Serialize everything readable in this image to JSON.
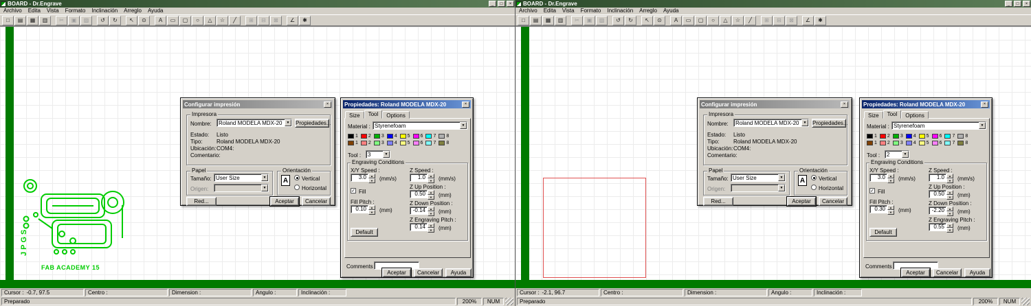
{
  "s": {
    "window_title": "BOARD - Dr.Engrave",
    "titlebar": {
      "minimize": "_",
      "maximize": "□",
      "close": "×"
    },
    "menu": [
      "Archivo",
      "Edita",
      "Vista",
      "Formato",
      "Inclinación",
      "Arreglo",
      "Ayuda"
    ],
    "toolbar": [
      {
        "name": "new",
        "glyph": "□"
      },
      {
        "name": "open",
        "glyph": "▤"
      },
      {
        "name": "save",
        "glyph": "▦"
      },
      {
        "name": "print",
        "glyph": "▥"
      },
      {
        "name": "cut",
        "glyph": "✂"
      },
      {
        "name": "copy",
        "glyph": "▣"
      },
      {
        "name": "paste",
        "glyph": "▨"
      },
      {
        "name": "undo",
        "glyph": "↺"
      },
      {
        "name": "redo",
        "glyph": "↻"
      },
      {
        "name": "select",
        "glyph": "↖"
      },
      {
        "name": "zoom",
        "glyph": "⊙"
      },
      {
        "name": "text",
        "glyph": "A"
      },
      {
        "name": "rectangle",
        "glyph": "▭"
      },
      {
        "name": "rounded-rectangle",
        "glyph": "▢"
      },
      {
        "name": "ellipse",
        "glyph": "○"
      },
      {
        "name": "polygon",
        "glyph": "△"
      },
      {
        "name": "star",
        "glyph": "☆"
      },
      {
        "name": "line",
        "glyph": "╱"
      },
      {
        "name": "align-left",
        "glyph": "⊞"
      },
      {
        "name": "align-center",
        "glyph": "⊟"
      },
      {
        "name": "align-right",
        "glyph": "⊠"
      },
      {
        "name": "measure",
        "glyph": "∠"
      },
      {
        "name": "settings",
        "glyph": "✱"
      }
    ],
    "print": {
      "title": "Configurar impresión",
      "close": "×",
      "printer_group": "Impresora",
      "name_label": "Nombre:",
      "printer_name": "Roland MODELA MDX-20",
      "properties_button": "Propiedades...",
      "status_label": "Estado:",
      "status_value": "Listo",
      "type_label": "Tipo:",
      "type_value": "Roland MODELA MDX-20",
      "location_label": "Ubicación:",
      "location_value": "COM4:",
      "comment_label": "Comentario:",
      "paper_group": "Papel",
      "size_label": "Tamaño:",
      "size_value": "User Size",
      "source_label": "Origen:",
      "orientation_group": "Orientación",
      "orientation_icon": "A",
      "vertical_label": "Vertical",
      "horizontal_label": "Horizontal",
      "network_button": "Red...",
      "ok_button": "Aceptar",
      "cancel_button": "Cancelar"
    },
    "props": {
      "title": "Propiedades: Roland MODELA MDX-20",
      "close": "×",
      "tabs": [
        "Size",
        "Tool",
        "Options"
      ],
      "material_label": "Material :",
      "material_value": "Styrenefoam",
      "tool_label": "Tool :",
      "conditions_group": "Engraving Conditions",
      "xy_speed_label": "X/Y Speed :",
      "z_speed_label": "Z Speed :",
      "fill_label": "Fill",
      "z_up_label": "Z Up Position :",
      "fill_pitch_label": "Fill Pitch :",
      "z_down_label": "Z Down Position :",
      "z_engraving_label": "Z Engraving Pitch :",
      "unit_mms": "(mm/s)",
      "unit_mm": "(mm)",
      "default_button": "Default",
      "comments_label": "Comments :",
      "ok_button": "Aceptar",
      "cancel_button": "Cancelar",
      "help_button": "Ayuda"
    },
    "palette": {
      "numbers": [
        "1",
        "2",
        "3",
        "4",
        "5",
        "6",
        "7",
        "8"
      ],
      "row1": [
        "#000000",
        "#ff0000",
        "#00b000",
        "#0000ff",
        "#ffff00",
        "#ff00ff",
        "#00ffff",
        "#b0b0b0"
      ],
      "row2": [
        "#804000",
        "#ff8080",
        "#80ff80",
        "#8080ff",
        "#ffff80",
        "#ff80ff",
        "#80ffff",
        "#808040"
      ]
    },
    "status": {
      "cursor_label": "Cursor :",
      "centro_label": "Centro :",
      "dimension_label": "Dimension :",
      "angulo_label": "Angulo :",
      "inclinacion_label": "Inclinación :",
      "ready": "Preparado",
      "zoom": "200%",
      "num": "NUM"
    },
    "colors": {
      "plate_green": "#007a00",
      "trace_green": "#00cc00",
      "rect_red": "#e05050",
      "active_title": "#0a246a"
    }
  },
  "w0": {
    "cursor_value": "-0.7, 97.5",
    "tool_value": "3",
    "xy_speed": "3.0",
    "z_speed": "1.0",
    "z_up": "0.50",
    "fill_pitch": "0.10",
    "z_down": "-0.14",
    "z_engraving": "0.14",
    "comments_value": "",
    "canvas": {
      "brand": "JPGS",
      "caption": "FAB ACADEMY 15"
    }
  },
  "w1": {
    "cursor_value": "-2.1, 96.7",
    "tool_value": "2",
    "xy_speed": "3.0",
    "z_speed": "1.0",
    "z_up": "0.50",
    "fill_pitch": "0.30",
    "z_down": "-2.20",
    "z_engraving": "0.55",
    "comments_value": ""
  }
}
